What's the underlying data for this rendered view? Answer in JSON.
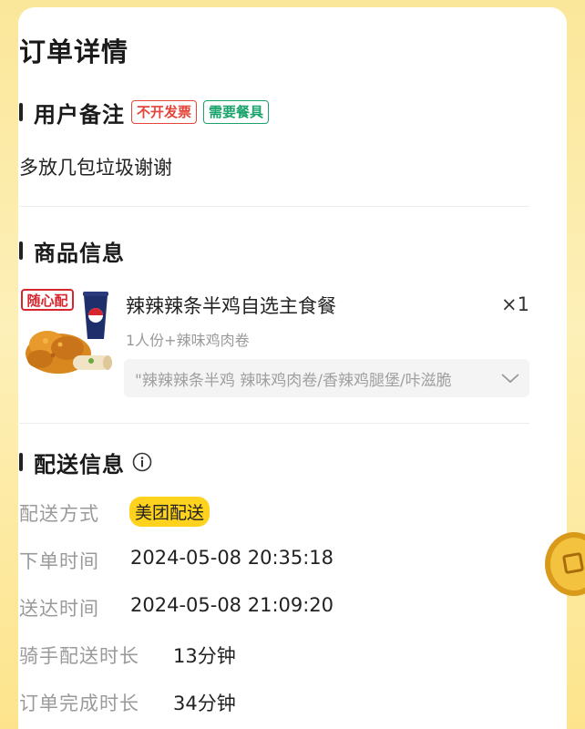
{
  "page": {
    "title": "订单详情"
  },
  "remarks": {
    "title": "用户备注",
    "tags": [
      {
        "label": "不开发票",
        "color": "#e5453a"
      },
      {
        "label": "需要餐具",
        "color": "#1aa36b"
      }
    ],
    "text": "多放几包垃圾谢谢"
  },
  "products": {
    "title": "商品信息",
    "items": [
      {
        "name": "辣辣辣条半鸡自选主食餐",
        "quantity": "×1",
        "spec": "1人份+辣味鸡肉卷",
        "detail": "\"辣辣辣条半鸡 辣味鸡肉卷/香辣鸡腿堡/咔滋脆",
        "image_logo_text": "随心配"
      }
    ]
  },
  "delivery": {
    "title": "配送信息",
    "info_icon": "info-icon",
    "rows": [
      {
        "label": "配送方式",
        "value": "美团配送"
      },
      {
        "label": "下单时间",
        "value": "2024-05-08 20:35:18"
      },
      {
        "label": "送达时间",
        "value": "2024-05-08 21:09:20"
      },
      {
        "label": "骑手配送时长",
        "value": "13分钟"
      },
      {
        "label": "订单完成时长",
        "value": "34分钟"
      }
    ]
  },
  "colors": {
    "accent_yellow": "#ffd21e",
    "background_yellow": "#fbe79a"
  }
}
